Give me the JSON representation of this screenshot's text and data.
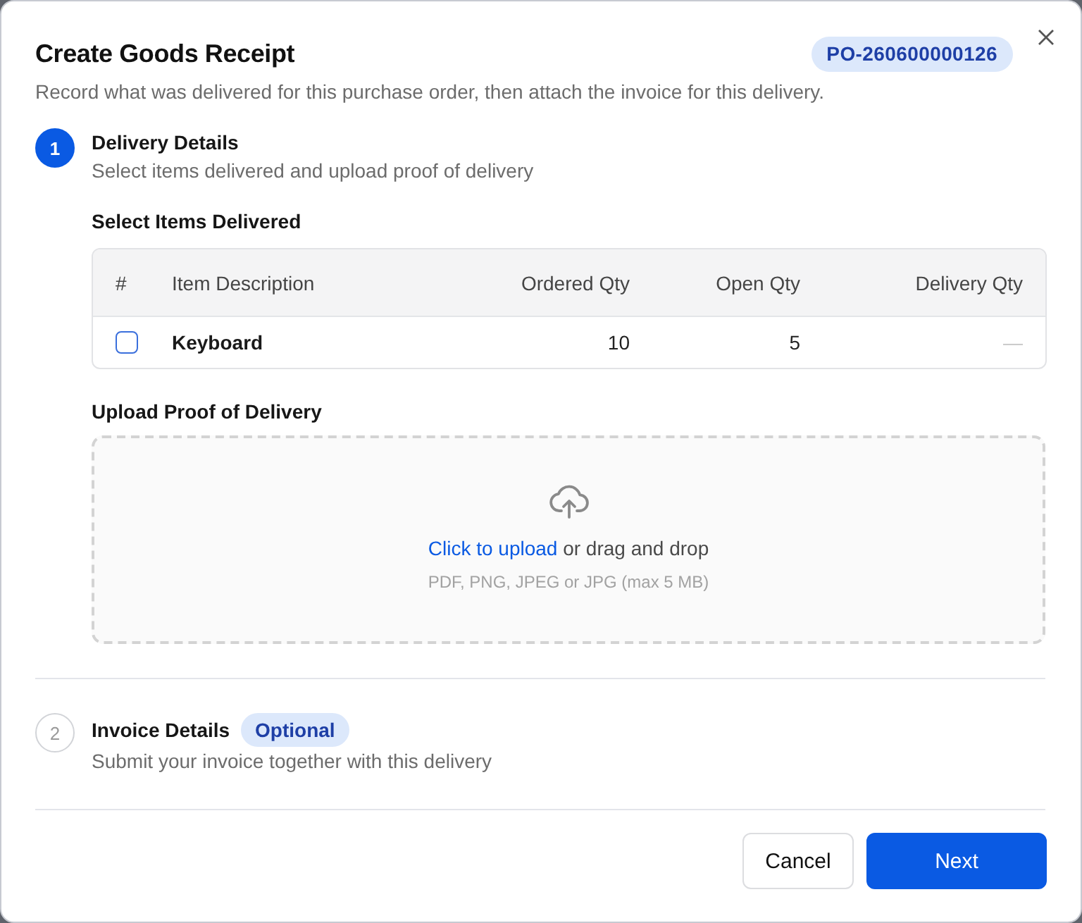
{
  "dialog": {
    "title": "Create Goods Receipt",
    "order_badge": "PO-260600000126",
    "subtitle": "Record what was delivered for this purchase order, then attach the invoice for this delivery."
  },
  "steps": [
    {
      "number": "1",
      "title": "Delivery Details",
      "description": "Select items delivered and upload proof of delivery",
      "selected": true,
      "items_heading": "Select Items Delivered",
      "table": {
        "columns": [
          "#",
          "Item Description",
          "Ordered Qty",
          "Open Qty",
          "Delivery Qty"
        ],
        "rows": [
          {
            "checked": false,
            "item": "Keyboard",
            "ordered_qty": "10",
            "open_qty": "5",
            "delivery_qty": "—"
          }
        ]
      },
      "upload_heading": "Upload Proof of Delivery",
      "upload": {
        "link": "Click to upload",
        "text": " or drag and drop",
        "hint": "PDF, PNG, JPEG or JPG (max 5 MB)"
      }
    },
    {
      "number": "2",
      "title": "Invoice Details",
      "badge": "Optional",
      "description": "Submit your invoice together with this delivery",
      "selected": false
    }
  ],
  "buttons": [
    {
      "label": "Cancel",
      "kind": "secondary"
    },
    {
      "label": "Next",
      "kind": "primary"
    }
  ]
}
